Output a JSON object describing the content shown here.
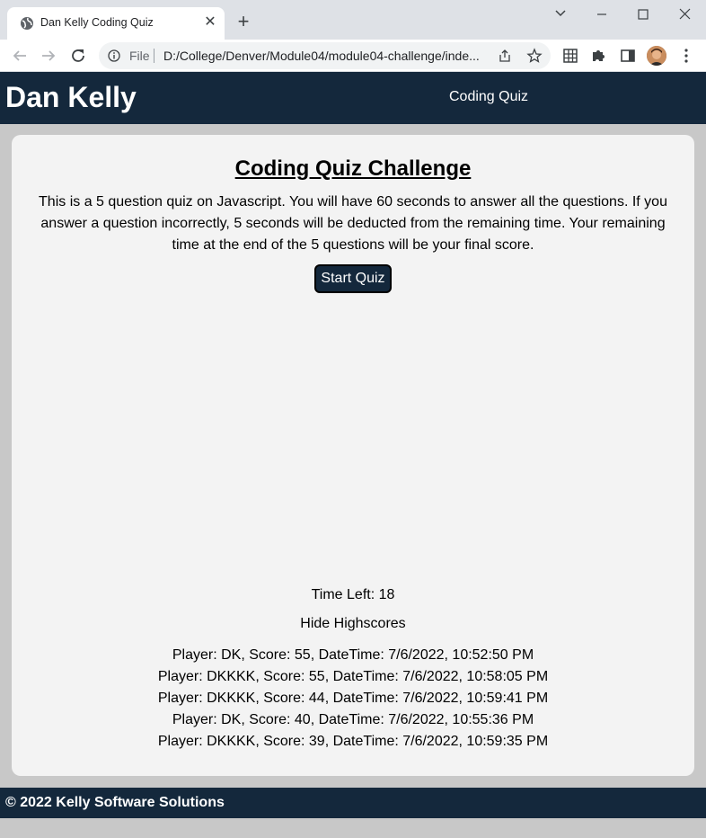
{
  "browser": {
    "tab_title": "Dan Kelly Coding Quiz",
    "close_glyph": "✕",
    "new_tab_glyph": "+",
    "address_scheme": "File",
    "address_url": "D:/College/Denver/Module04/module04-challenge/inde..."
  },
  "header": {
    "site_name": "Dan Kelly",
    "nav_label": "Coding Quiz"
  },
  "quiz": {
    "title": "Coding Quiz Challenge",
    "description": "This is a 5 question quiz on Javascript. You will have 60 seconds to answer all the questions. If you answer a question incorrectly, 5 seconds will be deducted from the remaining time. Your remaining time at the end of the 5 questions will be your final score.",
    "start_label": "Start Quiz",
    "time_left": "Time Left: 18",
    "hide_highscores_label": "Hide Highscores",
    "highscores": [
      "Player: DK, Score: 55, DateTime: 7/6/2022, 10:52:50 PM",
      "Player: DKKKK, Score: 55, DateTime: 7/6/2022, 10:58:05 PM",
      "Player: DKKKK, Score: 44, DateTime: 7/6/2022, 10:59:41 PM",
      "Player: DK, Score: 40, DateTime: 7/6/2022, 10:55:36 PM",
      "Player: DKKKK, Score: 39, DateTime: 7/6/2022, 10:59:35 PM"
    ]
  },
  "footer": {
    "text": "© 2022 Kelly Software Solutions"
  },
  "colors": {
    "brand_navy": "#14283c",
    "card_bg": "#f3f3f3",
    "page_bg": "#c8c8c8"
  },
  "icons": [
    "globe-icon",
    "close-icon",
    "plus-icon",
    "chevron-down-icon",
    "minimize-icon",
    "maximize-icon",
    "window-close-icon",
    "back-arrow-icon",
    "forward-arrow-icon",
    "reload-icon",
    "info-icon",
    "share-icon",
    "star-icon",
    "grid-icon",
    "puzzle-icon",
    "side-panel-icon",
    "avatar",
    "kebab-menu-icon"
  ]
}
